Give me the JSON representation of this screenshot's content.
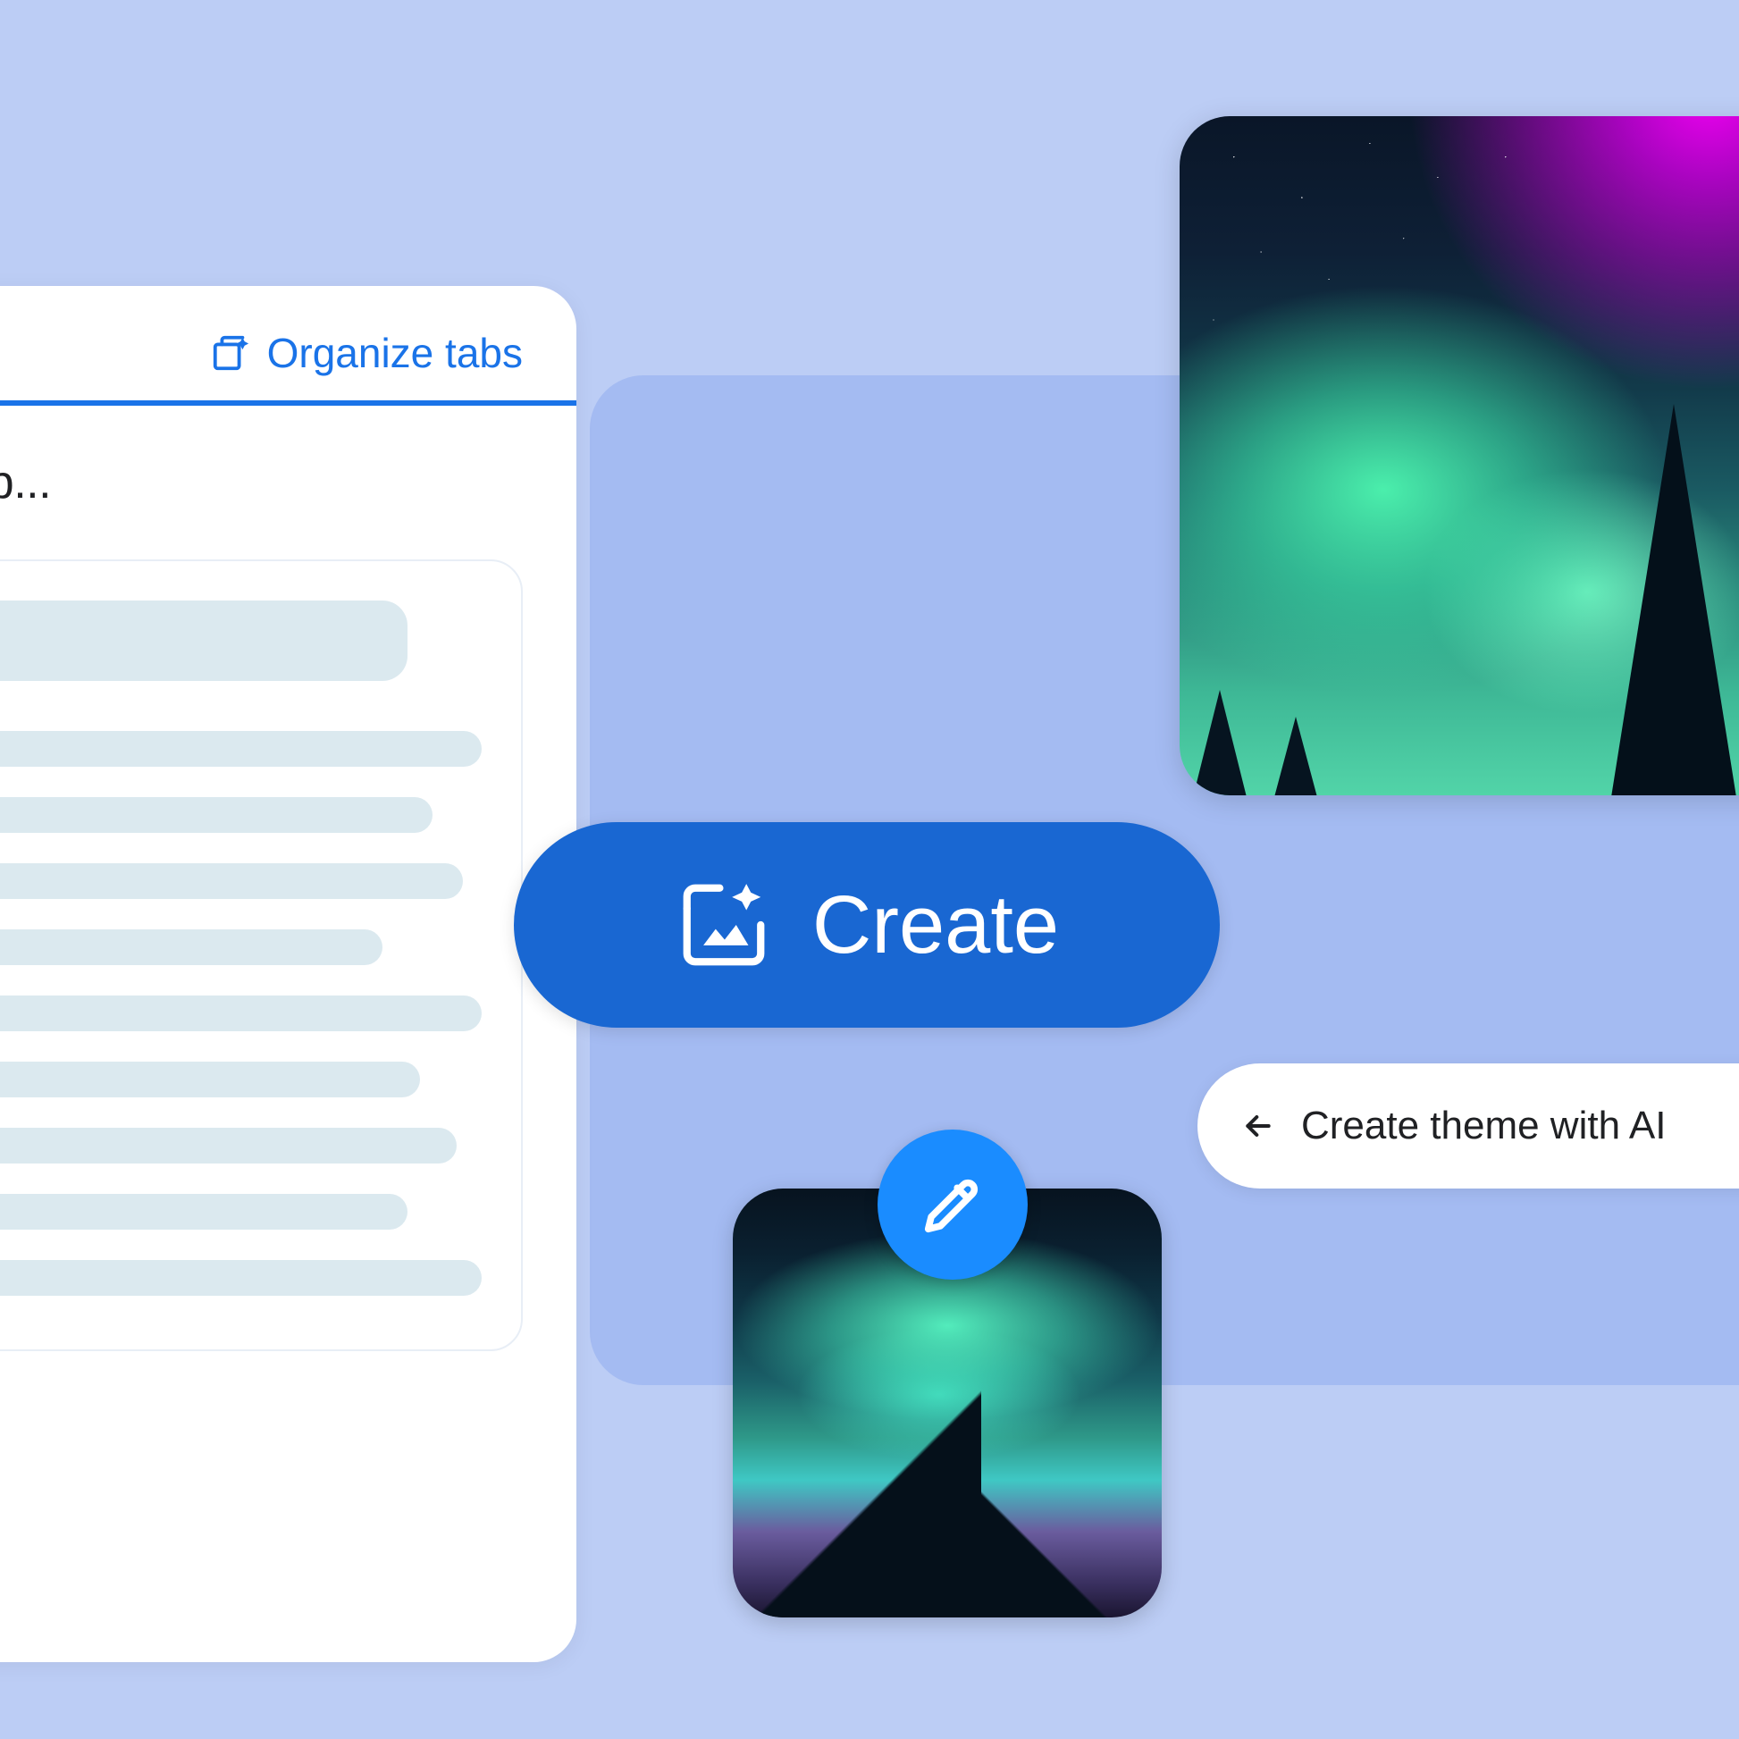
{
  "colors": {
    "bg_outer": "#bccdf5",
    "bg_panel": "#a4bbf2",
    "primary": "#1967d2",
    "primary_bright": "#1a8cff",
    "link": "#1a73e8",
    "text": "#202124",
    "skeleton": "#dbe9ef"
  },
  "tabs_card": {
    "organize_label": "Organize tabs",
    "subtitle": "tab group..."
  },
  "create_button": {
    "label": "Create"
  },
  "theme_pill": {
    "label": "Create theme with AI"
  },
  "icons": {
    "organize": "tab-sparkle-icon",
    "generate": "image-sparkle-icon",
    "edit": "pencil-icon",
    "back": "arrow-left-icon"
  },
  "thumbnails": {
    "large": "aurora-borealis-pixel-art-large",
    "small": "aurora-borealis-pixel-art-small"
  }
}
